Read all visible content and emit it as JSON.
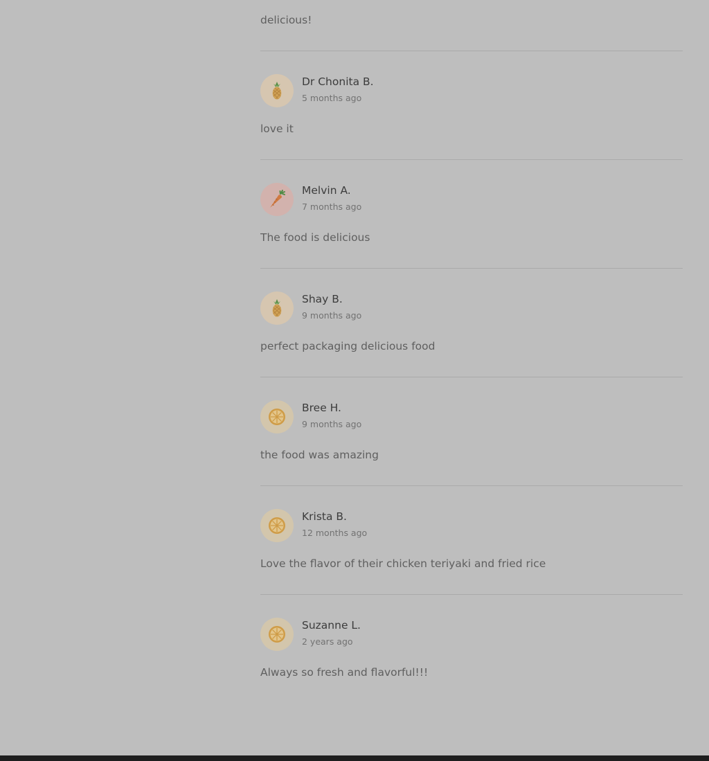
{
  "first_review_text": "delicious!",
  "reviews": [
    {
      "name": "Dr Chonita B.",
      "time": "5 months ago",
      "text": "love it",
      "avatar_icon": "pineapple-icon",
      "avatar_bg": "#d6c6b0"
    },
    {
      "name": "Melvin A.",
      "time": "7 months ago",
      "text": "The food is delicious",
      "avatar_icon": "carrot-icon",
      "avatar_bg": "#d2b2ad"
    },
    {
      "name": "Shay B.",
      "time": "9 months ago",
      "text": "perfect packaging delicious food",
      "avatar_icon": "pineapple-icon",
      "avatar_bg": "#d6c6b0"
    },
    {
      "name": "Bree H.",
      "time": "9 months ago",
      "text": "the food was amazing",
      "avatar_icon": "lemon-slice-icon",
      "avatar_bg": "#d3c6ac"
    },
    {
      "name": "Krista B.",
      "time": "12 months ago",
      "text": "Love the flavor of their chicken teriyaki and fried rice",
      "avatar_icon": "lemon-slice-icon",
      "avatar_bg": "#d3c6ac"
    },
    {
      "name": "Suzanne L.",
      "time": "2 years ago",
      "text": "Always so fresh and flavorful!!!",
      "avatar_icon": "lemon-slice-icon",
      "avatar_bg": "#d3c6ac"
    }
  ],
  "colors": {
    "page_bg": "#bebebe",
    "name_text": "#3c3c3c",
    "body_text": "#5f5f5f",
    "time_text": "#727272",
    "divider": "#aaaaaa",
    "bottom_bar": "#1e1e1e"
  }
}
